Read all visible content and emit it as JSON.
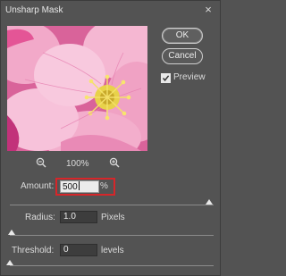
{
  "dialog": {
    "title": "Unsharp Mask",
    "close_glyph": "×"
  },
  "buttons": {
    "ok": "OK",
    "cancel": "Cancel"
  },
  "preview_toggle": {
    "label": "Preview",
    "checked": true
  },
  "zoom": {
    "level": "100%",
    "zoom_out_icon": "zoom-out-icon",
    "zoom_in_icon": "zoom-in-icon"
  },
  "amount": {
    "label": "Amount:",
    "value": "500",
    "unit": "%",
    "slider_level": 0.98
  },
  "radius": {
    "label": "Radius:",
    "value": "1.0",
    "unit": "Pixels",
    "slider_level": 0.01
  },
  "threshold": {
    "label": "Threshold:",
    "value": "0",
    "unit": "levels",
    "slider_level": 0.0
  },
  "colors": {
    "dialog_bg": "#535353",
    "highlight_border": "#d6262a",
    "preview_pink": "#e07aa8"
  }
}
